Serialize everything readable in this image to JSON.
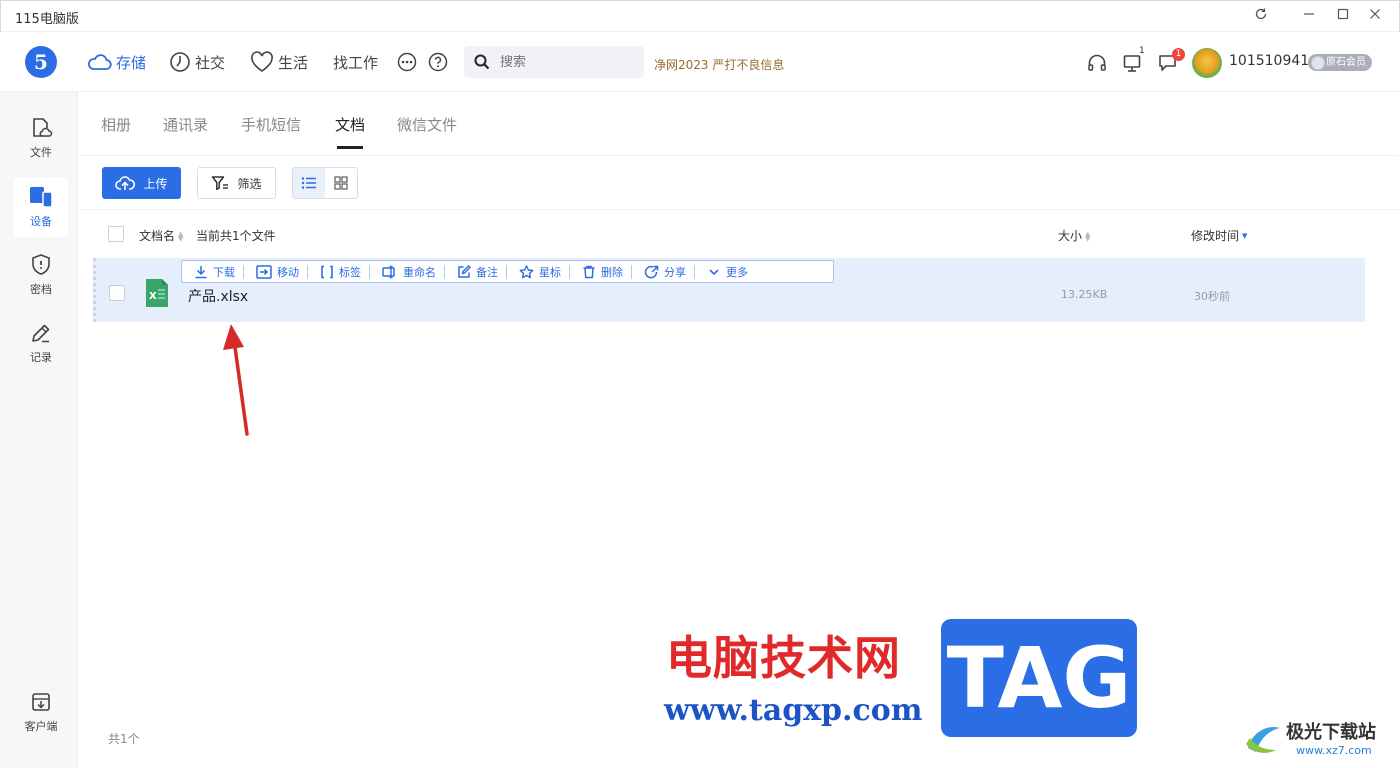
{
  "window": {
    "title": "115电脑版"
  },
  "header": {
    "logo": "5",
    "nav": [
      {
        "label": "存储",
        "icon": "cloud-icon"
      },
      {
        "label": "社交",
        "icon": "clock-icon"
      },
      {
        "label": "生活",
        "icon": "heart-icon"
      },
      {
        "label": "找工作"
      }
    ],
    "search_placeholder": "搜索",
    "promo": "净网2023 严打不良信息",
    "device_badge": "1",
    "message_badge": "1",
    "username": "101510941",
    "member_level": "原石会员"
  },
  "sidebar": {
    "items": [
      {
        "label": "文件",
        "icon": "file-cloud-icon"
      },
      {
        "label": "设备",
        "icon": "devices-icon"
      },
      {
        "label": "密档",
        "icon": "shield-icon"
      },
      {
        "label": "记录",
        "icon": "pencil-icon"
      }
    ],
    "bottom": {
      "label": "客户端",
      "icon": "download-box-icon"
    }
  },
  "tabs": [
    "相册",
    "通讯录",
    "手机短信",
    "文档",
    "微信文件"
  ],
  "active_tab": "文档",
  "toolbar": {
    "upload": "上传",
    "filter": "筛选"
  },
  "list": {
    "col_name": "文档名",
    "count_text": "当前共1个文件",
    "col_size": "大小",
    "col_time": "修改时间",
    "rows": [
      {
        "name": "产品.xlsx",
        "size": "13.25KB",
        "time": "30秒前"
      }
    ],
    "actions": [
      "下载",
      "移动",
      "标签",
      "重命名",
      "备注",
      "星标",
      "删除",
      "分享",
      "更多"
    ]
  },
  "footer": {
    "total": "共1个"
  },
  "watermark": {
    "cn": "电脑技术网",
    "url": "www.tagxp.com",
    "tag": "TAG",
    "site2_cn": "极光下载站",
    "site2_url": "www.xz7.com"
  },
  "colors": {
    "accent": "#2b6de4",
    "row_selected": "#e7eefb",
    "watermark_red": "#e02a2a"
  }
}
